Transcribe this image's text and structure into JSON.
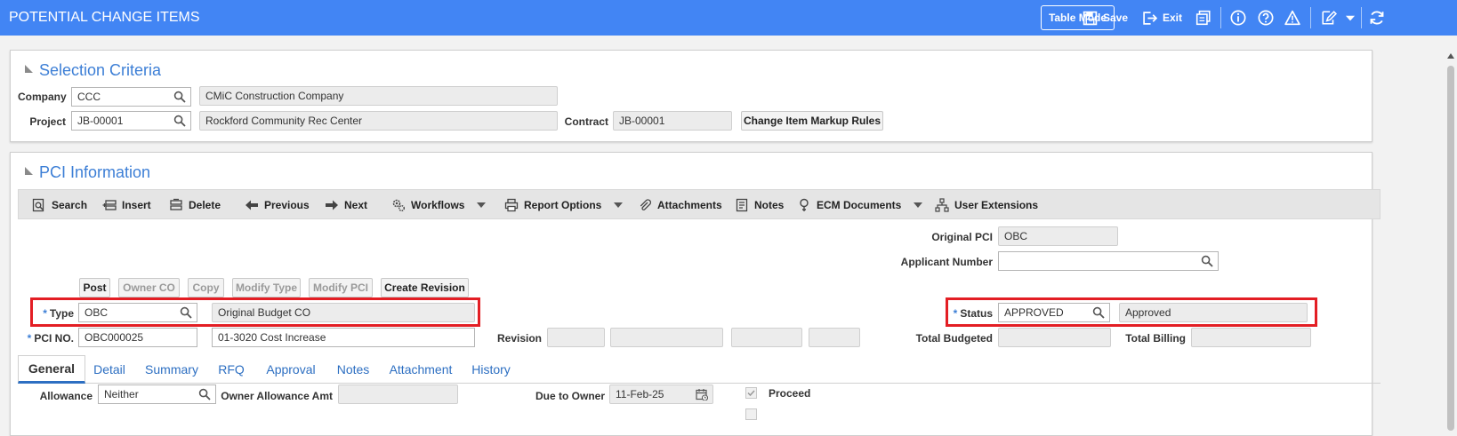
{
  "header": {
    "title": "POTENTIAL CHANGE ITEMS",
    "table_mode": "Table Mode",
    "save": "Save",
    "exit": "Exit"
  },
  "selection": {
    "title": "Selection Criteria",
    "company_label": "Company",
    "company_code": "CCC",
    "company_name": "CMiC Construction Company",
    "project_label": "Project",
    "project_code": "JB-00001",
    "project_name": "Rockford Community Rec Center",
    "contract_label": "Contract",
    "contract_value": "JB-00001",
    "markup_button": "Change Item Markup Rules"
  },
  "pci": {
    "title": "PCI Information",
    "toolbar": {
      "search": "Search",
      "insert": "Insert",
      "delete": "Delete",
      "previous": "Previous",
      "next": "Next",
      "workflows": "Workflows",
      "report_options": "Report Options",
      "attachments": "Attachments",
      "notes": "Notes",
      "ecm_documents": "ECM Documents",
      "user_extensions": "User Extensions"
    },
    "original_pci_label": "Original PCI",
    "original_pci_value": "OBC",
    "applicant_label": "Applicant Number",
    "applicant_value": "",
    "actions": {
      "post": "Post",
      "owner_co": "Owner CO",
      "copy": "Copy",
      "modify_type": "Modify Type",
      "modify_pci": "Modify PCI",
      "create_revision": "Create Revision"
    },
    "required_mark": "*",
    "type_label": "Type",
    "type_code": "OBC",
    "type_desc": "Original Budget CO",
    "status_label": "Status",
    "status_code": "APPROVED",
    "status_desc": "Approved",
    "pci_no_label": "PCI NO.",
    "pci_no_value": "OBC000025",
    "pci_desc": "01-3020 Cost Increase",
    "revision_label": "Revision",
    "total_budgeted_label": "Total Budgeted",
    "total_billing_label": "Total Billing"
  },
  "tabs": [
    "General",
    "Detail",
    "Summary",
    "RFQ",
    "Approval",
    "Notes",
    "Attachment",
    "History"
  ],
  "general": {
    "allowance_label": "Allowance",
    "allowance_value": "Neither",
    "owner_allowance_label": "Owner Allowance Amt",
    "due_to_owner_label": "Due to Owner",
    "due_to_owner_value": "11-Feb-25",
    "proceed_label": "Proceed"
  },
  "colors": {
    "header_bg": "#4285f4",
    "accent": "#3d7fd6",
    "highlight": "#e31e24"
  }
}
